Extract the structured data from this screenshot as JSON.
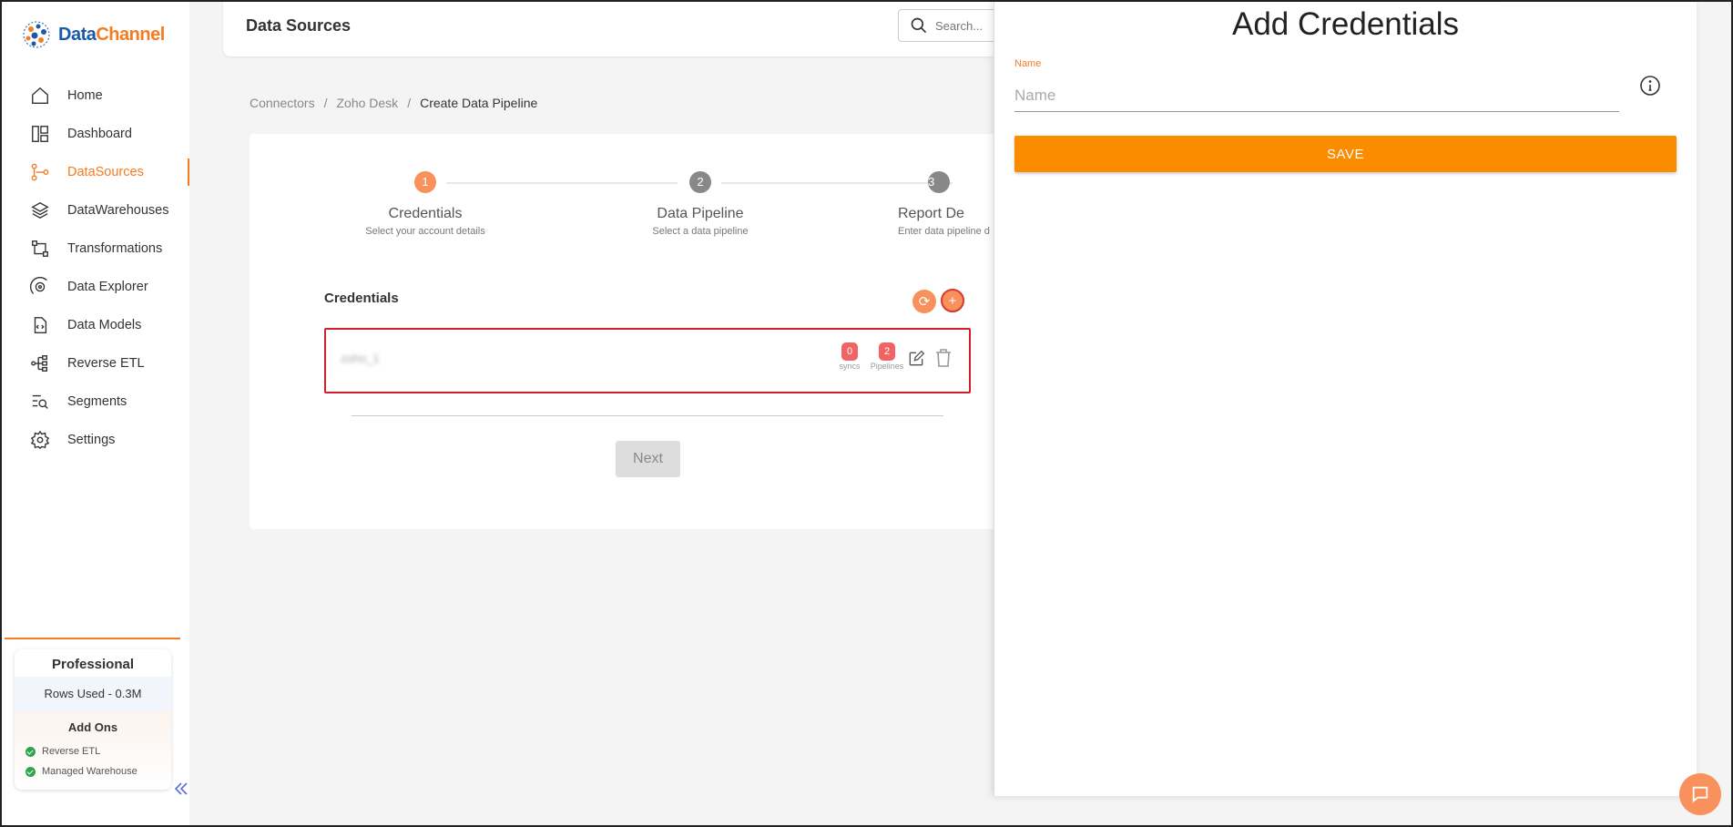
{
  "brand": {
    "part1": "Data",
    "part2": "Channel",
    "orange": "#f57c20",
    "blue": "#1a5aa8"
  },
  "sidebar": {
    "items": [
      {
        "label": "Home",
        "icon": "home-icon"
      },
      {
        "label": "Dashboard",
        "icon": "dashboard-icon"
      },
      {
        "label": "DataSources",
        "icon": "datasources-icon",
        "active": true
      },
      {
        "label": "DataWarehouses",
        "icon": "layers-icon"
      },
      {
        "label": "Transformations",
        "icon": "transform-icon"
      },
      {
        "label": "Data Explorer",
        "icon": "explorer-icon"
      },
      {
        "label": "Data Models",
        "icon": "data-models-icon"
      },
      {
        "label": "Reverse ETL",
        "icon": "reverse-etl-icon"
      },
      {
        "label": "Segments",
        "icon": "segments-icon"
      },
      {
        "label": "Settings",
        "icon": "gear-icon"
      }
    ],
    "plan": {
      "name": "Professional",
      "rows_used": "Rows Used - 0.3M",
      "addons_title": "Add Ons",
      "addons": [
        "Reverse ETL",
        "Managed Warehouse"
      ]
    }
  },
  "header": {
    "title": "Data Sources",
    "search_placeholder": "Search..."
  },
  "breadcrumb": {
    "items": [
      "Connectors",
      "Zoho Desk",
      "Create Data Pipeline"
    ]
  },
  "steps": [
    {
      "num": "1",
      "label": "Credentials",
      "sub": "Select your account details"
    },
    {
      "num": "2",
      "label": "Data Pipeline",
      "sub": "Select a data pipeline"
    },
    {
      "num": "3",
      "label": "Report De",
      "sub": "Enter data pipeline d"
    }
  ],
  "credentials": {
    "title": "Credentials",
    "refresh_symbol": "⟳",
    "add_symbol": "+",
    "row": {
      "name": "zoho_1",
      "syncs": "0",
      "syncs_label": "syncs",
      "pipelines": "2",
      "pipelines_label": "Pipelines"
    }
  },
  "next_label": "Next",
  "panel": {
    "title": "Add Credentials",
    "name_label": "Name",
    "name_placeholder": "Name",
    "name_value": "",
    "save_label": "SAVE"
  }
}
